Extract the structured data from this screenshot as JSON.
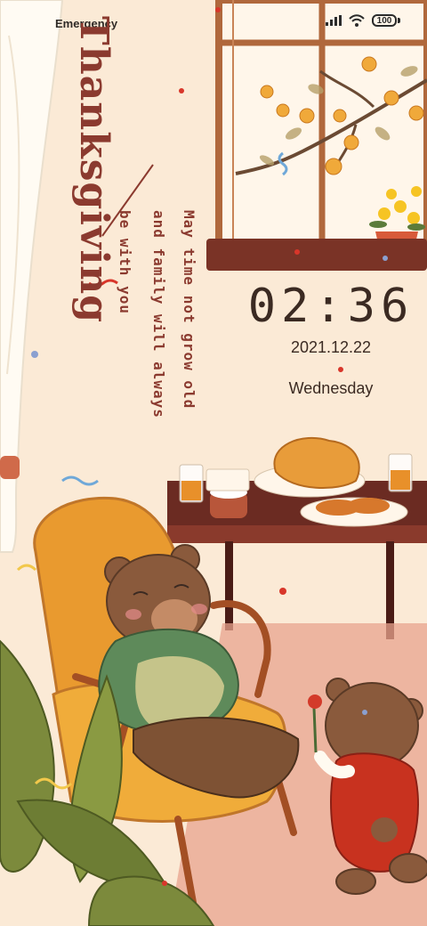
{
  "status_bar": {
    "carrier_text": "Emergency",
    "battery_level": "100",
    "signal_icon": "signal-bars-icon",
    "wifi_icon": "wifi-icon"
  },
  "wallpaper": {
    "title": "Thanksgiving",
    "slogan": {
      "line1": "May time not grow old",
      "line2": "and family will always",
      "line3": "be with you"
    }
  },
  "lockscreen": {
    "time": "02:36",
    "date": "2021.12.22",
    "weekday": "Wednesday"
  },
  "colors": {
    "background": "#fbead6",
    "title": "#8b3a2f",
    "clock_text": "#3b2a22",
    "table": "#6b2b22",
    "window_frame": "#b0683c",
    "chair": "#e99a2f",
    "bear_fur": "#8a5a3c",
    "sweater": "#5e8a5a",
    "overalls": "#c8321f"
  }
}
